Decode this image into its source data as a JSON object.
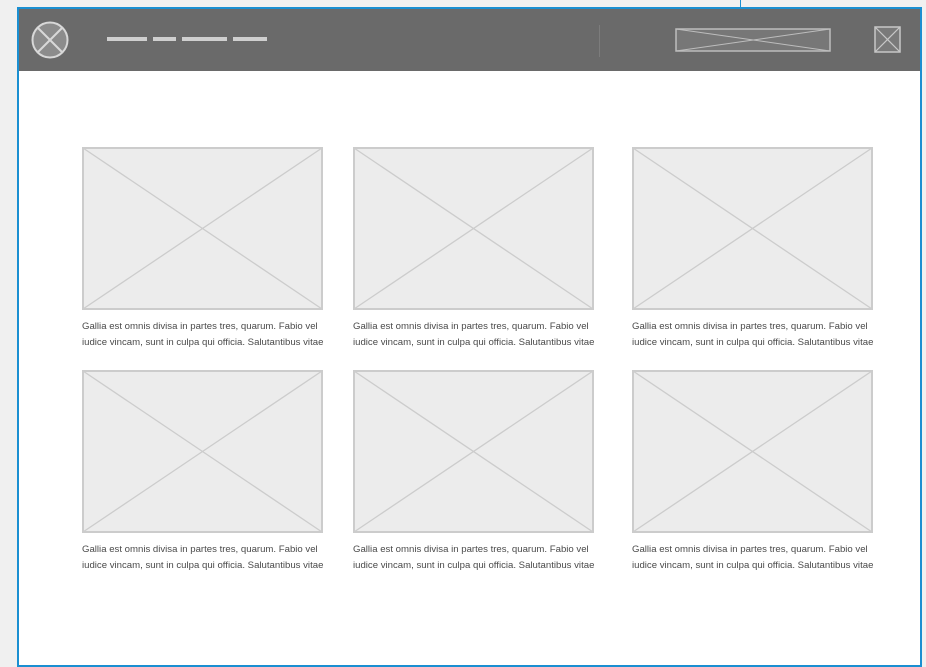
{
  "cards": [
    {
      "line1": "Gallia est omnis divisa in partes tres, quarum. Fabio vel",
      "line2": "iudice vincam, sunt in culpa qui officia. Salutantibus vitae"
    },
    {
      "line1": "Gallia est omnis divisa in partes tres, quarum. Fabio vel",
      "line2": "iudice vincam, sunt in culpa qui officia. Salutantibus vitae"
    },
    {
      "line1": "Gallia est omnis divisa in partes tres, quarum. Fabio vel",
      "line2": "iudice vincam, sunt in culpa qui officia. Salutantibus vitae"
    },
    {
      "line1": "Gallia est omnis divisa in partes tres, quarum. Fabio vel",
      "line2": "iudice vincam, sunt in culpa qui officia. Salutantibus vitae"
    },
    {
      "line1": "Gallia est omnis divisa in partes tres, quarum. Fabio vel",
      "line2": "iudice vincam, sunt in culpa qui officia. Salutantibus vitae"
    },
    {
      "line1": "Gallia est omnis divisa in partes tres, quarum. Fabio vel",
      "line2": "iudice vincam, sunt in culpa qui officia. Salutantibus vitae"
    }
  ],
  "icons": {
    "logo": "circle-x-logo-icon",
    "search": "search-field-placeholder",
    "close": "close-box-icon",
    "image": "image-placeholder"
  },
  "colors": {
    "topbar": "#6a6a6a",
    "accent": "#1a8fd1",
    "placeholder_fill": "#ececec",
    "placeholder_stroke": "#cccccc",
    "text": "#4a4a4a"
  }
}
